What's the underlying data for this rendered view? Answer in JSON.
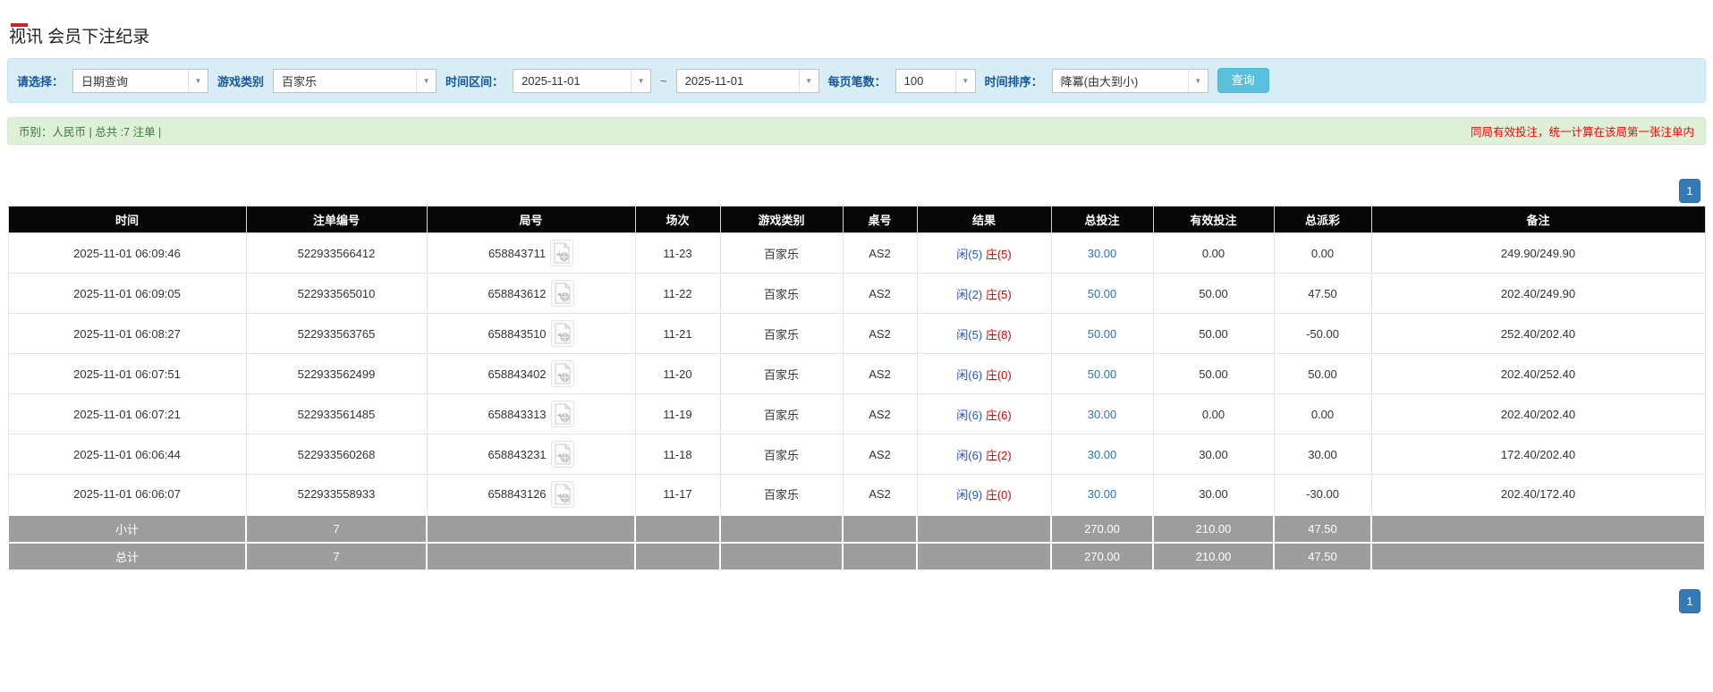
{
  "page": {
    "title": "视讯 会员下注纪录"
  },
  "filters": {
    "select_label": "请选择：",
    "select_value": "日期查询",
    "game_label": "游戏类别",
    "game_value": "百家乐",
    "range_label": "时间区间：",
    "date_from": "2025-11-01",
    "tilde": "~",
    "date_to": "2025-11-01",
    "per_page_label": "每页笔数：",
    "per_page_value": "100",
    "sort_label": "时间排序：",
    "sort_value": "降冪(由大到小)",
    "search_button": "查询"
  },
  "summary": {
    "left": "币别：人民币 | 总共 :7 注单 |",
    "right": "同局有效投注，统一计算在该局第一张注单内"
  },
  "pagination": {
    "page": "1"
  },
  "icons": {
    "video_replay": "video-file-icon",
    "dropdown": "▼"
  },
  "colors": {
    "accent_blue": "#337ab7",
    "search_blue": "#5bc0de",
    "header_black": "#060606",
    "player_blue": "#2a52cc",
    "banker_red": "#e00000",
    "negative_red": "#e00000",
    "summary_green_bg": "#dff0d8",
    "filter_blue_bg": "#d9edf7",
    "total_grey": "#9d9d9d"
  },
  "table": {
    "columns": [
      "时间",
      "注单编号",
      "局号",
      "场次",
      "游戏类别",
      "桌号",
      "结果",
      "总投注",
      "有效投注",
      "总派彩",
      "备注"
    ],
    "rows": [
      {
        "time": "2025-11-01 06:09:46",
        "bet_id": "522933566412",
        "round_id": "658843711",
        "session": "11-23",
        "game": "百家乐",
        "table_no": "AS2",
        "result_player": "闲(5)",
        "result_banker": "庄(5)",
        "total_bet": "30.00",
        "valid_bet": "0.00",
        "payout": "0.00",
        "note": "249.90/249.90"
      },
      {
        "time": "2025-11-01 06:09:05",
        "bet_id": "522933565010",
        "round_id": "658843612",
        "session": "11-22",
        "game": "百家乐",
        "table_no": "AS2",
        "result_player": "闲(2)",
        "result_banker": "庄(5)",
        "total_bet": "50.00",
        "valid_bet": "50.00",
        "payout": "47.50",
        "note": "202.40/249.90"
      },
      {
        "time": "2025-11-01 06:08:27",
        "bet_id": "522933563765",
        "round_id": "658843510",
        "session": "11-21",
        "game": "百家乐",
        "table_no": "AS2",
        "result_player": "闲(5)",
        "result_banker": "庄(8)",
        "total_bet": "50.00",
        "valid_bet": "50.00",
        "payout": "-50.00",
        "note": "252.40/202.40"
      },
      {
        "time": "2025-11-01 06:07:51",
        "bet_id": "522933562499",
        "round_id": "658843402",
        "session": "11-20",
        "game": "百家乐",
        "table_no": "AS2",
        "result_player": "闲(6)",
        "result_banker": "庄(0)",
        "total_bet": "50.00",
        "valid_bet": "50.00",
        "payout": "50.00",
        "note": "202.40/252.40"
      },
      {
        "time": "2025-11-01 06:07:21",
        "bet_id": "522933561485",
        "round_id": "658843313",
        "session": "11-19",
        "game": "百家乐",
        "table_no": "AS2",
        "result_player": "闲(6)",
        "result_banker": "庄(6)",
        "total_bet": "30.00",
        "valid_bet": "0.00",
        "payout": "0.00",
        "note": "202.40/202.40"
      },
      {
        "time": "2025-11-01 06:06:44",
        "bet_id": "522933560268",
        "round_id": "658843231",
        "session": "11-18",
        "game": "百家乐",
        "table_no": "AS2",
        "result_player": "闲(6)",
        "result_banker": "庄(2)",
        "total_bet": "30.00",
        "valid_bet": "30.00",
        "payout": "30.00",
        "note": "172.40/202.40"
      },
      {
        "time": "2025-11-01 06:06:07",
        "bet_id": "522933558933",
        "round_id": "658843126",
        "session": "11-17",
        "game": "百家乐",
        "table_no": "AS2",
        "result_player": "闲(9)",
        "result_banker": "庄(0)",
        "total_bet": "30.00",
        "valid_bet": "30.00",
        "payout": "-30.00",
        "note": "202.40/172.40"
      }
    ],
    "totals": [
      {
        "label": "小计",
        "count": "7",
        "total_bet": "270.00",
        "valid_bet": "210.00",
        "payout": "47.50"
      },
      {
        "label": "总计",
        "count": "7",
        "total_bet": "270.00",
        "valid_bet": "210.00",
        "payout": "47.50"
      }
    ]
  }
}
